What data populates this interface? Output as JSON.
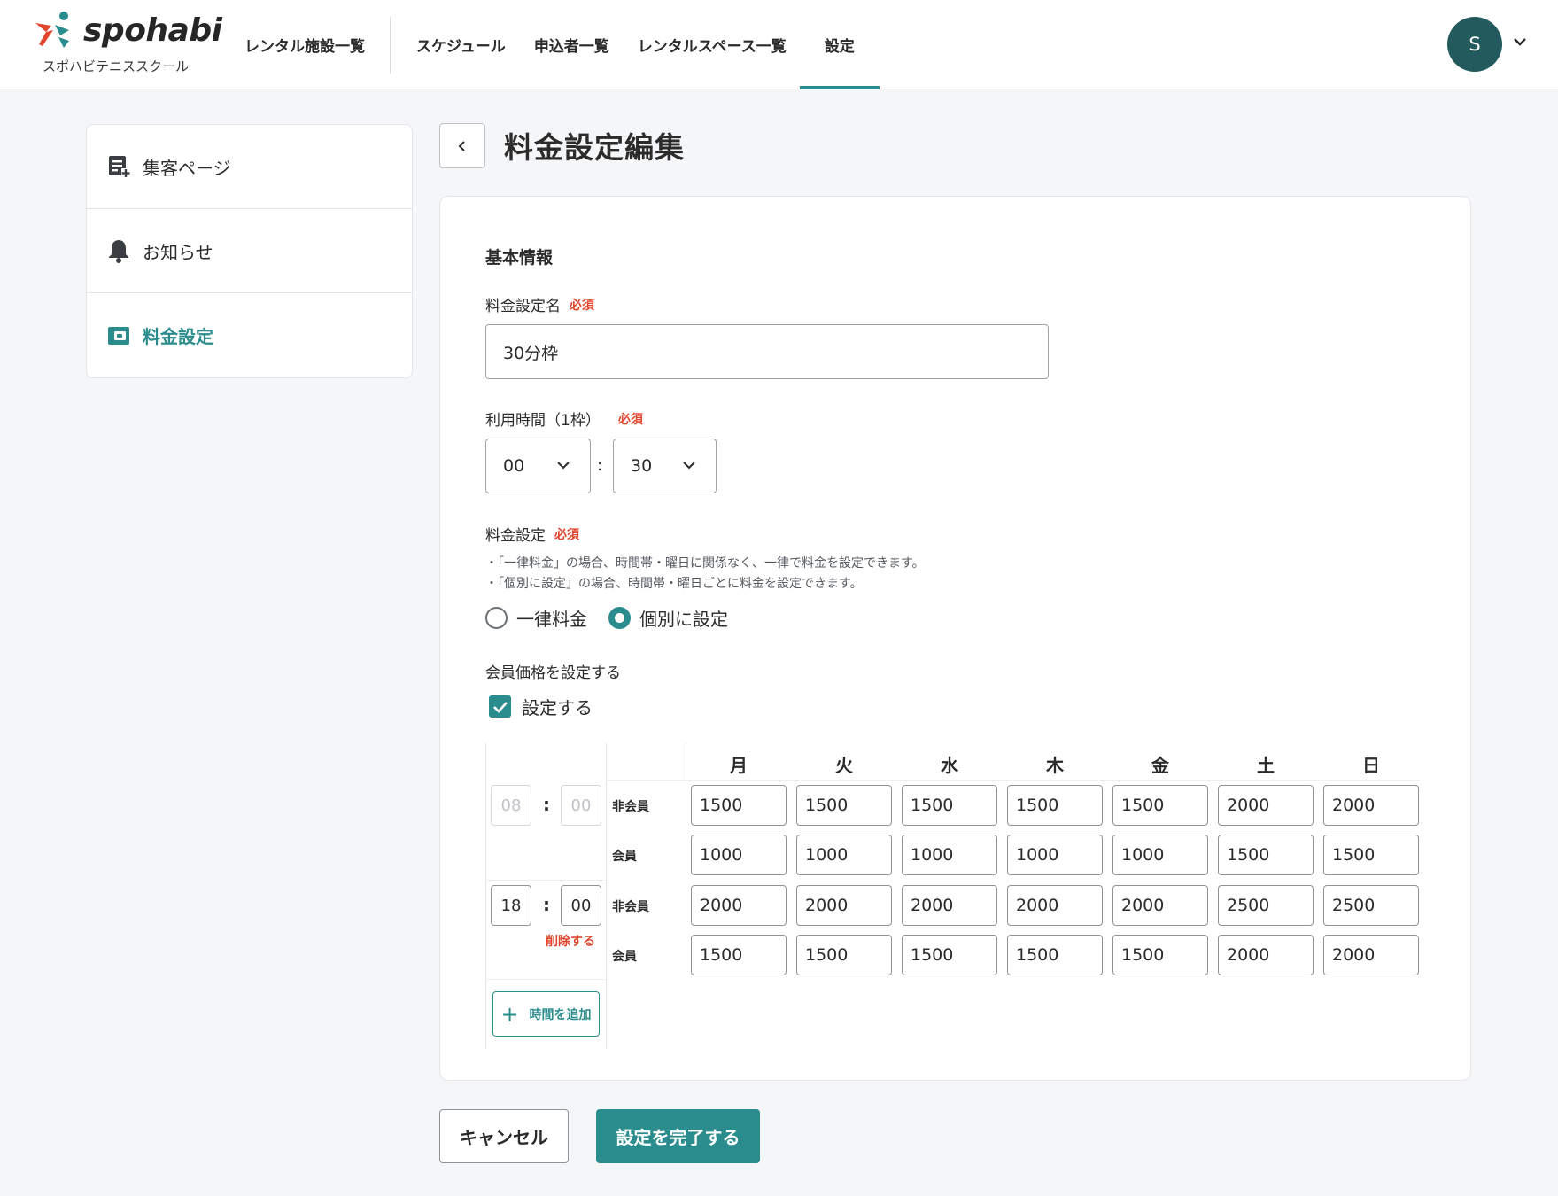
{
  "brand": {
    "logo_text": "spohabi",
    "school_name": "スポハビテニススクール"
  },
  "nav": {
    "items": [
      {
        "label": "レンタル施設一覧"
      },
      {
        "label": "スケジュール"
      },
      {
        "label": "申込者一覧"
      },
      {
        "label": "レンタルスペース一覧"
      },
      {
        "label": "設定",
        "active": true
      }
    ]
  },
  "user": {
    "initial": "S"
  },
  "sidebar": {
    "items": [
      {
        "label": "集客ページ",
        "icon": "page-plus-icon"
      },
      {
        "label": "お知らせ",
        "icon": "bell-icon"
      },
      {
        "label": "料金設定",
        "icon": "wallet-icon",
        "active": true
      }
    ]
  },
  "page": {
    "title": "料金設定編集"
  },
  "form": {
    "section_title": "基本情報",
    "required_badge": "必須",
    "name": {
      "label": "料金設定名",
      "value": "30分枠"
    },
    "duration": {
      "label": "利用時間（1枠）",
      "hours": "00",
      "minutes": "30",
      "separator": ":"
    },
    "pricing": {
      "label": "料金設定",
      "notes": [
        "・「一律料金」の場合、時間帯・曜日に関係なく、一律で料金を設定できます。",
        "・「個別に設定」の場合、時間帯・曜日ごとに料金を設定できます。"
      ],
      "options": [
        {
          "label": "一律料金",
          "checked": false
        },
        {
          "label": "個別に設定",
          "checked": true
        }
      ]
    },
    "member_price": {
      "label": "会員価格を設定する",
      "checkbox_label": "設定する",
      "checked": true
    }
  },
  "price_table": {
    "days": [
      "月",
      "火",
      "水",
      "木",
      "金",
      "土",
      "日"
    ],
    "time_separator": ":",
    "row_labels": {
      "non_member": "非会員",
      "member": "会員"
    },
    "delete_label": "削除する",
    "add_time_label": "時間を追加",
    "blocks": [
      {
        "start_hour": "08",
        "start_minute": "00",
        "disabled": true,
        "non_member": [
          "1500",
          "1500",
          "1500",
          "1500",
          "1500",
          "2000",
          "2000"
        ],
        "member": [
          "1000",
          "1000",
          "1000",
          "1000",
          "1000",
          "1500",
          "1500"
        ]
      },
      {
        "start_hour": "18",
        "start_minute": "00",
        "disabled": false,
        "non_member": [
          "2000",
          "2000",
          "2000",
          "2000",
          "2000",
          "2500",
          "2500"
        ],
        "member": [
          "1500",
          "1500",
          "1500",
          "1500",
          "1500",
          "2000",
          "2000"
        ]
      }
    ]
  },
  "actions": {
    "cancel": "キャンセル",
    "submit": "設定を完了する"
  },
  "colors": {
    "accent": "#2a8c8c",
    "required": "#e0462e",
    "avatar": "#235a5e"
  }
}
